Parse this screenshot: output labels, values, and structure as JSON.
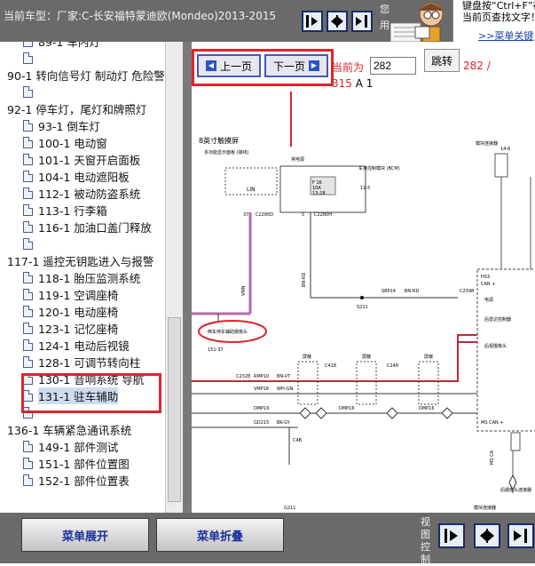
{
  "header": {
    "car_model": "当前车型：厂家:C-长安福特蒙迪欧(Mondeo)2013-2015",
    "vertical_text": "您用",
    "nav_buttons": [
      "expand-right-icon",
      "collapse-left-icon"
    ],
    "hint_text": "键盘按“Ctrl+F”在当前页查找文字！",
    "hint_link": ">>菜单关键"
  },
  "sidebar": {
    "items": [
      {
        "level": 1,
        "label": "89-1 车内灯"
      },
      {
        "level": 1,
        "label": ""
      },
      {
        "level": 0,
        "label": "90-1 转向信号灯 制动灯 危险警"
      },
      {
        "level": 1,
        "label": ""
      },
      {
        "level": 0,
        "label": "92-1 停车灯，尾灯和牌照灯"
      },
      {
        "level": 1,
        "label": "93-1 倒车灯"
      },
      {
        "level": 1,
        "label": "100-1 电动窗"
      },
      {
        "level": 1,
        "label": "101-1 天窗开启面板"
      },
      {
        "level": 1,
        "label": "104-1 电动遮阳板"
      },
      {
        "level": 1,
        "label": "112-1 被动防盗系统"
      },
      {
        "level": 1,
        "label": "113-1 行李箱"
      },
      {
        "level": 1,
        "label": "116-1 加油口盖门释放"
      },
      {
        "level": 1,
        "label": ""
      },
      {
        "level": 0,
        "label": "117-1 遥控无钥匙进入与报警"
      },
      {
        "level": 1,
        "label": "118-1 胎压监测系统"
      },
      {
        "level": 1,
        "label": "119-1 空调座椅"
      },
      {
        "level": 1,
        "label": "120-1 电动座椅"
      },
      {
        "level": 1,
        "label": "123-1 记忆座椅"
      },
      {
        "level": 1,
        "label": "124-1 电动后视镜"
      },
      {
        "level": 1,
        "label": "128-1 可调节转向柱"
      },
      {
        "level": 1,
        "label": "130-1 音响系统 导航"
      },
      {
        "level": 1,
        "label": "131-1 驻车辅助",
        "selected": true
      },
      {
        "level": 1,
        "label": ""
      },
      {
        "level": 0,
        "label": "136-1 车辆紧急通讯系统"
      },
      {
        "level": 1,
        "label": "149-1 部件测试"
      },
      {
        "level": 1,
        "label": "151-1 部件位置图"
      },
      {
        "level": 1,
        "label": "152-1 部件位置表"
      }
    ]
  },
  "pager": {
    "prev_label": "上一页",
    "next_label": "下一页",
    "current_label": "当前为",
    "page_value": "282",
    "jump_label": "跳转",
    "total_text": "282 /",
    "suffix_total": "315",
    "suffix_text": " A 1"
  },
  "diagram": {
    "title": "8英寸触摸屏",
    "labels": {
      "top_left": "多功能显示面板 (接线)",
      "power": "常电源",
      "bcm": "车身控制模块 (BCM)",
      "fuse_f": "F 16",
      "fuse_a": "10A",
      "fuse_ref": "13-28",
      "bcm_ref": "11-5",
      "lin": "LIN",
      "conn1": "C2280D",
      "conn2": "C2280H",
      "pin1": "37",
      "pin2": "5",
      "wire_v1": "VMN",
      "wire_v2": "BN-RD",
      "wire_s1": "SBP14",
      "wire_s1c": "BN-RD",
      "s211": "S211",
      "c2398": "C2398",
      "hs3": "HS3",
      "can": "CAN +",
      "power_r": "电源",
      "radar": "后雷达控制器",
      "camera": "后视摄像头",
      "ms_can": "MS CAN +",
      "rear_cam_conn": "后摄像头连接器",
      "note": "倒车停车辅助摄像头",
      "ref_151": "151-37",
      "w_rmp10": "RMP10",
      "w_bnvt": "BN-VT",
      "w_vmp16": "VMP16",
      "w_whgn": "WH-GN",
      "w_dmp16": "DMP16",
      "w_gd215": "GD215",
      "w_bkgy": "BK-GY",
      "c4b": "C4B",
      "c2328": "C2328",
      "c418": "C418",
      "c248": "C248",
      "dmp16b": "DMP16",
      "dmp16c": "DMP16",
      "g211": "G211",
      "ms_l": "MS CA",
      "ref_14": "14-6",
      "small1": "屏蔽",
      "small2": "屏蔽",
      "small3": "屏蔽",
      "top_right": "模块连接器",
      "bot_right": "模块连接器"
    }
  },
  "footer": {
    "expand_label": "菜单展开",
    "collapse_label": "菜单折叠",
    "view_label": "视图控制"
  },
  "colors": {
    "highlight_red": "#e0242c",
    "bar_gray": "#6a6a6a",
    "button_blue_text": "#1a2f9a",
    "wire_red": "#c0283a",
    "wire_purple": "#b06ab0"
  }
}
